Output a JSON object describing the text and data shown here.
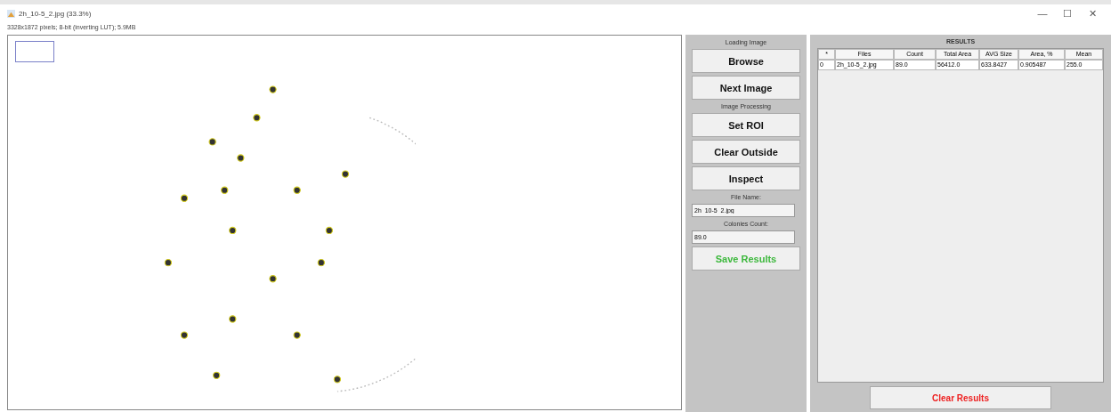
{
  "window": {
    "title": "2h_10-5_2.jpg (33.3%)",
    "info": "3328x1872 pixels; 8-bit (inverting LUT); 5.9MB",
    "controls": [
      "—",
      "☐",
      "✕"
    ]
  },
  "image": {
    "kind": "picture",
    "roi_selected": true
  },
  "panel": [
    {
      "kind": "heading",
      "text": "Loading Image"
    },
    {
      "kind": "button",
      "text": "Browse",
      "color": "#111111"
    },
    {
      "kind": "button",
      "text": "Next Image",
      "color": "#111111"
    },
    {
      "kind": "heading",
      "text": "Image Processing"
    },
    {
      "kind": "button",
      "text": "Set ROI",
      "color": "#111111"
    },
    {
      "kind": "button",
      "text": "Clear Outside",
      "color": "#111111"
    },
    {
      "kind": "button",
      "text": "Inspect",
      "color": "#111111"
    },
    {
      "kind": "heading",
      "text": "File Name:"
    },
    {
      "kind": "field",
      "text": "2h_10-5_2.jpg"
    },
    {
      "kind": "heading",
      "text": "Colonies Count:"
    },
    {
      "kind": "field",
      "text": "89.0"
    },
    {
      "kind": "button",
      "text": "Save Results",
      "color": "#3cb83c"
    }
  ],
  "results": {
    "title": "RESULTS",
    "columns": [
      "*",
      "Files",
      "Count",
      "Total Area",
      "AVG Size",
      "Area, %",
      "Mean"
    ],
    "rows": [
      [
        "0",
        "2h_10-5_2.jpg",
        "89.0",
        "56412.0",
        "633.8427",
        "0.905487",
        "255.0"
      ]
    ],
    "clear_button": {
      "text": "Clear Results",
      "color": "#ee2222"
    }
  }
}
